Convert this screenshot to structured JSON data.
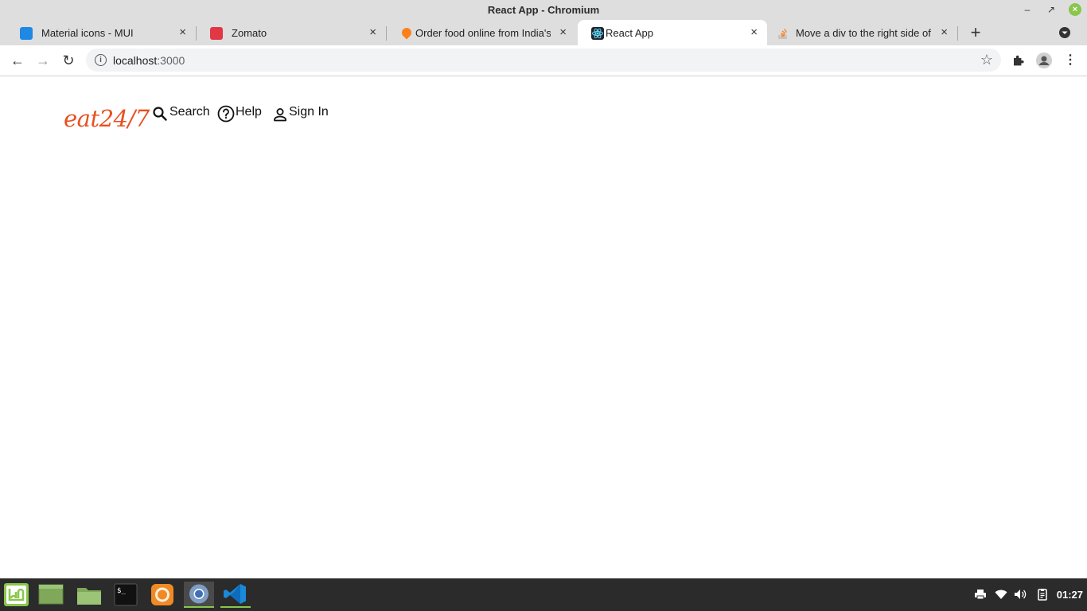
{
  "window": {
    "title": "React App - Chromium"
  },
  "tabs": [
    {
      "label": "Material icons - MUI",
      "icon": "mui-favicon",
      "color": "#1e88e5"
    },
    {
      "label": "Zomato",
      "icon": "zomato-favicon",
      "color": "#e23744"
    },
    {
      "label": "Order food online from India's",
      "icon": "swiggy-favicon",
      "color": "#fc8019"
    },
    {
      "label": "React App",
      "icon": "react-favicon",
      "color": "#61dafb"
    },
    {
      "label": "Move a div to the right side of",
      "icon": "stackoverflow-favicon",
      "color": "#f48024"
    }
  ],
  "toolbar": {
    "url_host": "localhost",
    "url_port": ":3000"
  },
  "page": {
    "logo": "eat24/7",
    "logo_color": "#e8501f",
    "nav": {
      "search": "Search",
      "help": "Help",
      "signin": "Sign In"
    }
  },
  "taskbar": {
    "clock": "01:27",
    "accent": "#8ac64d"
  }
}
